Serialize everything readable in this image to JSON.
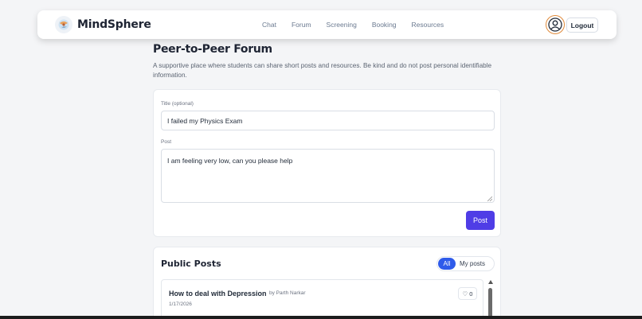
{
  "brand": {
    "name": "MindSphere",
    "logo_icon": "brain-globe-icon"
  },
  "nav": {
    "links": [
      "Chat",
      "Forum",
      "Screening",
      "Booking",
      "Resources"
    ],
    "avatar_icon": "user-avatar-icon",
    "logout_label": "Logout"
  },
  "header": {
    "title": "Peer-to-Peer Forum",
    "description": "A supportive place where students can share short posts and resources. Be kind and do not post personal identifiable information."
  },
  "form": {
    "title_label": "Title (optional)",
    "title_value": "I failed my Physics Exam",
    "post_label": "Post",
    "post_value": "I am feeling very low, can you please help",
    "submit_label": "Post"
  },
  "posts": {
    "heading": "Public Posts",
    "filters": {
      "all": "All",
      "mine": "My posts",
      "selected": "All"
    },
    "items": [
      {
        "title": "How to deal with Depression",
        "author": "by Parth Narkar",
        "date": "1/17/2026",
        "likes": "♡ 0"
      }
    ]
  },
  "colors": {
    "accent": "#4f3de6",
    "filter_active": "#2f5bea",
    "avatar_ring": "#e08a3a",
    "background": "#f4f5f7"
  }
}
